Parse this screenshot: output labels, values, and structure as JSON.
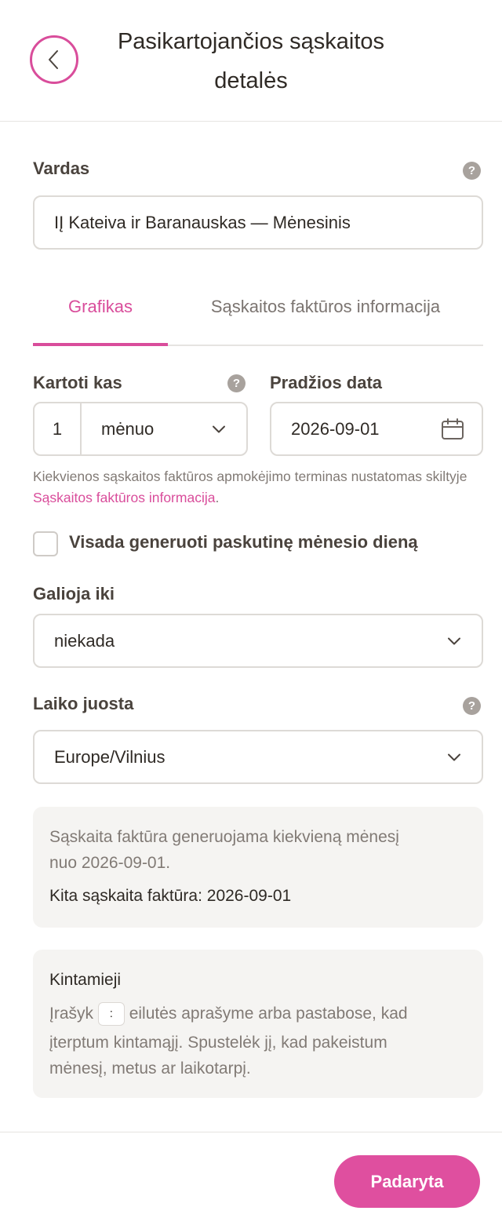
{
  "header": {
    "title_line1": "Pasikartojančios sąskaitos",
    "title_line2": "detalės",
    "back_icon": "chevron-left-icon"
  },
  "name": {
    "label": "Vardas",
    "value": "IĮ Kateiva ir Baranauskas — Mėnesinis",
    "help_icon": "help-icon"
  },
  "tabs": [
    {
      "label": "Grafikas",
      "active": true
    },
    {
      "label": "Sąskaitos faktūros informacija",
      "active": false
    }
  ],
  "schedule": {
    "repeat_label": "Kartoti kas",
    "repeat_count": "1",
    "repeat_unit": "mėnuo",
    "start_label": "Pradžios data",
    "start_date": "2026-09-01",
    "hint_text": "Kiekvienos sąskaitos faktūros apmokėjimo terminas nustatomas skiltyje ",
    "hint_link": "Sąskaitos faktūros informacija",
    "hint_end": ".",
    "last_day_label": "Visada generuoti paskutinę mėnesio dieną",
    "last_day_checked": false,
    "valid_until_label": "Galioja iki",
    "valid_until_value": "niekada",
    "timezone_label": "Laiko juosta",
    "timezone_value": "Europe/Vilnius"
  },
  "summary": {
    "line1": "Sąskaita faktūra generuojama kiekvieną mėnesį",
    "line2": "nuo 2026-09-01.",
    "next_invoice": "Kita sąskaita faktūra: 2026-09-01"
  },
  "variables": {
    "title": "Kintamieji",
    "text_before": "Įrašyk",
    "code": ":",
    "text_after": "eilutės aprašyme arba pastabose, kad",
    "line2": "įterptum kintamąjį. Spustelėk jį, kad pakeistum",
    "line3": "mėnesį, metus ar laikotarpį."
  },
  "footer": {
    "done_label": "Padaryta"
  },
  "colors": {
    "accent": "#d94d9b",
    "button": "#df4f9f",
    "panel_bg": "#f5f4f2",
    "border": "#dddad6"
  }
}
